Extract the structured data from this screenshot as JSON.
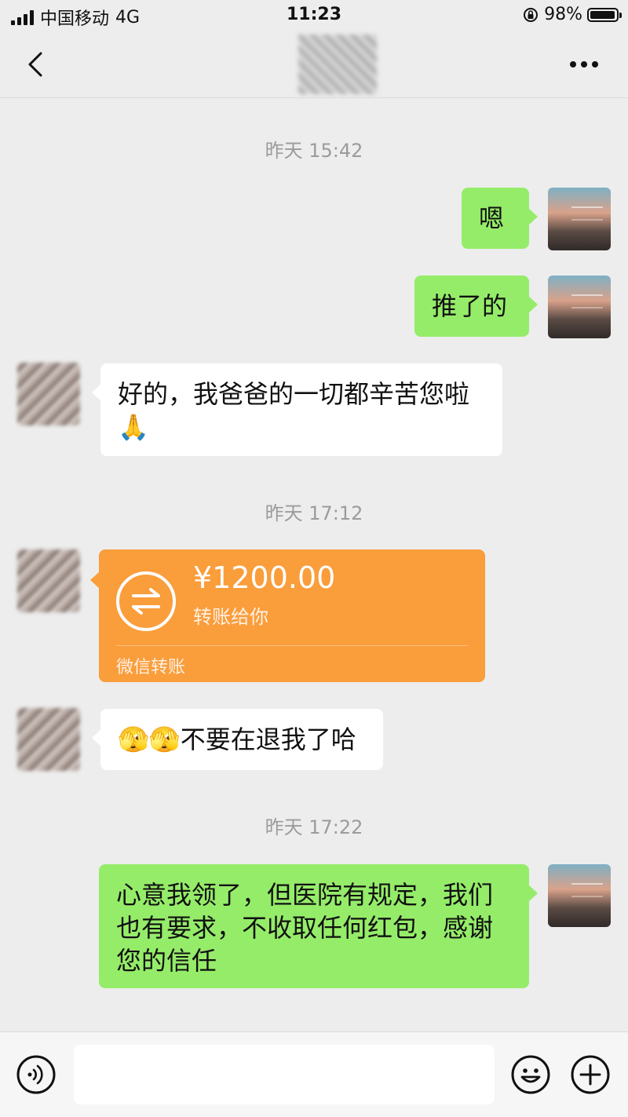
{
  "status_bar": {
    "carrier": "中国移动",
    "network": "4G",
    "time": "11:23",
    "battery": "98%",
    "battery_level": 0.98
  },
  "nav": {
    "back_icon": "chevron-left-icon",
    "more_icon": "more-dots-icon"
  },
  "messages": [
    {
      "type": "time",
      "text": "昨天 15:42"
    },
    {
      "type": "text",
      "side": "right",
      "text": "嗯"
    },
    {
      "type": "text",
      "side": "right",
      "text": "推了的"
    },
    {
      "type": "text",
      "side": "left",
      "text": "好的，我爸爸的一切都辛苦您啦🙏"
    },
    {
      "type": "time",
      "text": "昨天 17:12"
    },
    {
      "type": "transfer",
      "side": "left",
      "amount": "¥1200.00",
      "subtitle": "转账给你",
      "footer": "微信转账"
    },
    {
      "type": "text",
      "side": "left",
      "text": "🫣🫣不要在退我了哈"
    },
    {
      "type": "time",
      "text": "昨天 17:22"
    },
    {
      "type": "text",
      "side": "right",
      "text": "心意我领了，但医院有规定，我们也有要求，不收取任何红包，感谢您的信任"
    }
  ],
  "input_bar": {
    "value": "",
    "voice_icon": "voice-icon",
    "emoji_icon": "emoji-icon",
    "plus_icon": "plus-icon"
  },
  "colors": {
    "background": "#ededed",
    "self_bubble": "#95ec69",
    "other_bubble": "#ffffff",
    "transfer_card": "#fa9d3b"
  }
}
